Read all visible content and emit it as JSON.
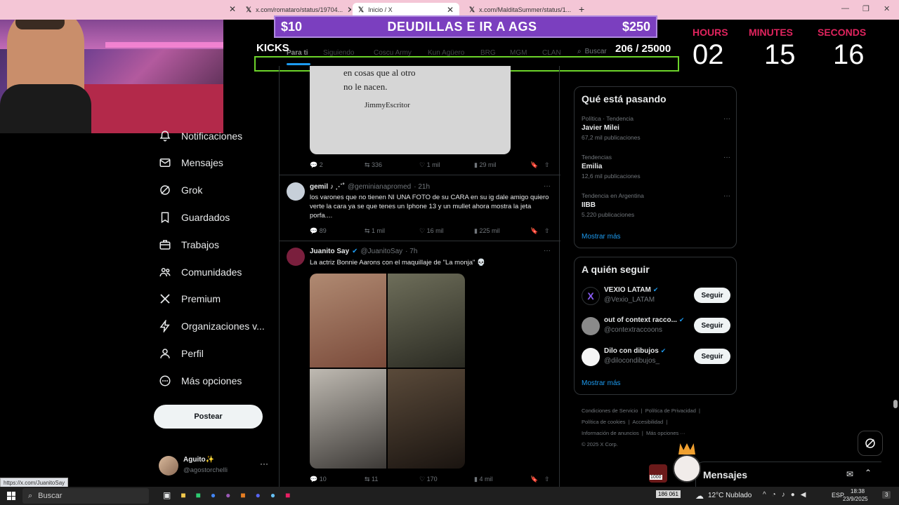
{
  "browser": {
    "tabs": [
      {
        "label": "x.com/romataro/status/19704..."
      },
      {
        "label": "Inicio / X"
      },
      {
        "label": "x.com/MalditaSummer/status/1..."
      }
    ],
    "new_tab": "+"
  },
  "overlay": {
    "goal_left": "$10",
    "goal_text": "DEUDILLAS E IR A AGS",
    "goal_right": "$250",
    "kicks_label": "KICKS",
    "kicks_count": "206 / 25000",
    "timer": {
      "hours_label": "HOURS",
      "minutes_label": "MINUTES",
      "seconds_label": "SECONDS",
      "hours": "02",
      "minutes": "15",
      "seconds": "16"
    }
  },
  "x_tabs": [
    "Para ti",
    "Siguiendo",
    "Coscu Army",
    "Kun Agüero",
    "BRG",
    "MGM",
    "CLAN"
  ],
  "search_placeholder": "Buscar",
  "left_nav": [
    {
      "label": "Notificaciones",
      "icon": "bell-icon"
    },
    {
      "label": "Mensajes",
      "icon": "envelope-icon"
    },
    {
      "label": "Grok",
      "icon": "grok-icon"
    },
    {
      "label": "Guardados",
      "icon": "bookmark-icon"
    },
    {
      "label": "Trabajos",
      "icon": "briefcase-icon"
    },
    {
      "label": "Comunidades",
      "icon": "people-icon"
    },
    {
      "label": "Premium",
      "icon": "x-logo-icon"
    },
    {
      "label": "Organizaciones v...",
      "icon": "lightning-icon"
    },
    {
      "label": "Perfil",
      "icon": "person-icon"
    },
    {
      "label": "Más opciones",
      "icon": "more-circle-icon"
    }
  ],
  "post_button": "Postear",
  "account": {
    "name": "Aguito✨",
    "handle": "@agostorchelli"
  },
  "status_url": "https://x.com/JuanitoSay",
  "feed": {
    "quote_image_lines": [
      "en cosas que al otro",
      "no le nacen."
    ],
    "quote_image_signature": "JimmyEscritor",
    "post0_actions": {
      "replies": "2",
      "reposts": "336",
      "likes": "1 mil",
      "views": "29 mil"
    },
    "post1": {
      "name": "gemil ♪ ⋰˚",
      "handle": "@geminianapromed",
      "time": "· 21h",
      "text": "los varones que no tienen NI UNA FOTO de su CARA en su ig dale amigo quiero verte la cara ya se que tenes un Iphone 13 y un mullet ahora mostra la jeta porfa....",
      "actions": {
        "replies": "89",
        "reposts": "1 mil",
        "likes": "16 mil",
        "views": "225 mil"
      }
    },
    "post2": {
      "name": "Juanito Say",
      "handle": "@JuanitoSay",
      "time": "· 7h",
      "text": "La actriz Bonnie Aarons con el maquillaje de \"La monja\" 💀",
      "actions": {
        "replies": "10",
        "reposts": "11",
        "likes": "170",
        "views": "4 mil"
      }
    }
  },
  "trends": {
    "title": "Qué está pasando",
    "items": [
      {
        "category": "Política · Tendencia",
        "name": "Javier Milei",
        "count": "67,2 mil publicaciones"
      },
      {
        "category": "Tendencias",
        "name": "Emilia",
        "count": "12,6 mil publicaciones"
      },
      {
        "category": "Tendencia en Argentina",
        "name": "IIBB",
        "count": "5.220 publicaciones"
      }
    ],
    "show_more": "Mostrar más"
  },
  "who_to_follow": {
    "title": "A quién seguir",
    "items": [
      {
        "name": "VEXIO LATAM",
        "handle": "@Vexio_LATAM",
        "button": "Seguir"
      },
      {
        "name": "out of context racco...",
        "handle": "@contextraccoons",
        "button": "Seguir"
      },
      {
        "name": "Dilo con dibujos",
        "handle": "@dilocondibujos_",
        "button": "Seguir"
      }
    ],
    "show_more": "Mostrar más"
  },
  "footer_links": [
    "Condiciones de Servicio",
    "Política de Privacidad",
    "Política de cookies",
    "Accesibilidad",
    "Información de anuncios",
    "Más opciones ···",
    "© 2025 X Corp."
  ],
  "messages_drawer": "Mensajes",
  "taskbar": {
    "search": "Buscar",
    "weather": "12°C  Nublado",
    "lang": "ESP",
    "time": "18:38",
    "date": "23/9/2025",
    "counter": "186 061",
    "badge": "1000",
    "notif": "3"
  },
  "colors": {
    "accent": "#1d9bf0",
    "goal_purple": "#7b3fbf",
    "kick_green": "#6cd32a",
    "timer_red": "#e0245e"
  }
}
